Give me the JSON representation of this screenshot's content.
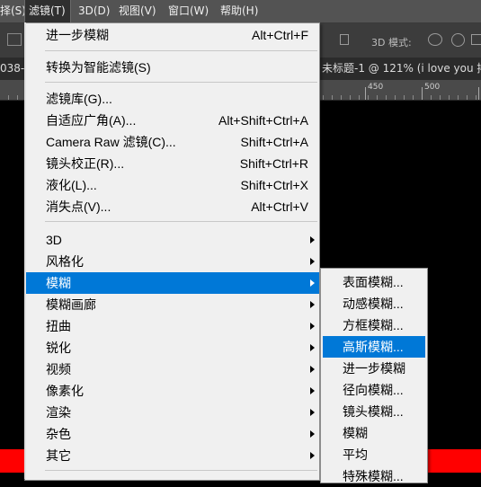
{
  "menubar": {
    "items": [
      {
        "label": "择(S)"
      },
      {
        "label": "滤镜(T)"
      },
      {
        "label": "3D(D)"
      },
      {
        "label": "视图(V)"
      },
      {
        "label": "窗口(W)"
      },
      {
        "label": "帮助(H)"
      }
    ]
  },
  "options_bar": {
    "mode_label": "3D 模式:"
  },
  "document_tab": {
    "left_fragment": "038-",
    "right_fragment": "未标题-1 @ 121% (i  love  you 拷"
  },
  "ruler": {
    "ticks": [
      "450",
      "500",
      "550"
    ]
  },
  "filter_menu": {
    "top_items": [
      {
        "label": "进一步模糊",
        "shortcut": "Alt+Ctrl+F"
      }
    ],
    "convert_item": {
      "label": "转换为智能滤镜(S)"
    },
    "shortcut_items": [
      {
        "label": "滤镜库(G)...",
        "shortcut": ""
      },
      {
        "label": "自适应广角(A)...",
        "shortcut": "Alt+Shift+Ctrl+A"
      },
      {
        "label": "Camera Raw 滤镜(C)...",
        "shortcut": "Shift+Ctrl+A"
      },
      {
        "label": "镜头校正(R)...",
        "shortcut": "Shift+Ctrl+R"
      },
      {
        "label": "液化(L)...",
        "shortcut": "Shift+Ctrl+X"
      },
      {
        "label": "消失点(V)...",
        "shortcut": "Alt+Ctrl+V"
      }
    ],
    "submenu_items": [
      {
        "label": "3D"
      },
      {
        "label": "风格化"
      },
      {
        "label": "模糊",
        "highlighted": true
      },
      {
        "label": "模糊画廊"
      },
      {
        "label": "扭曲"
      },
      {
        "label": "锐化"
      },
      {
        "label": "视频"
      },
      {
        "label": "像素化"
      },
      {
        "label": "渲染"
      },
      {
        "label": "杂色"
      },
      {
        "label": "其它"
      }
    ]
  },
  "blur_submenu": {
    "items": [
      {
        "label": "表面模糊..."
      },
      {
        "label": "动感模糊..."
      },
      {
        "label": "方框模糊..."
      },
      {
        "label": "高斯模糊...",
        "highlighted": true
      },
      {
        "label": "进一步模糊"
      },
      {
        "label": "径向模糊..."
      },
      {
        "label": "镜头模糊..."
      },
      {
        "label": "模糊"
      },
      {
        "label": "平均"
      },
      {
        "label": "特殊模糊..."
      }
    ]
  },
  "colors": {
    "highlight": "#0078d7",
    "menu_bg": "#f0f0f0",
    "menubar_bg": "#535353",
    "canvas_red": "#ff0000"
  }
}
